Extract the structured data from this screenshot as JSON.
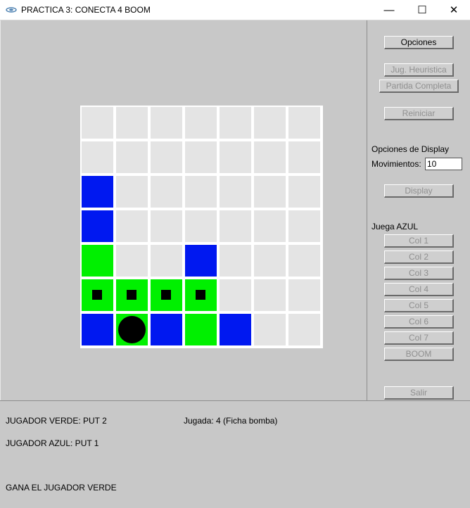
{
  "window": {
    "title": "PRACTICA 3: CONECTA 4 BOOM",
    "minimize_glyph": "—",
    "maximize_glyph": "☐",
    "close_glyph": "✕"
  },
  "board": {
    "rows": 7,
    "cols": 7,
    "colors": {
      "empty": "#e4e4e4",
      "blue": "#0018f0",
      "green": "#00f000",
      "marker": "#000000"
    },
    "cells": [
      [
        "empty",
        "empty",
        "empty",
        "empty",
        "empty",
        "empty",
        "empty"
      ],
      [
        "empty",
        "empty",
        "empty",
        "empty",
        "empty",
        "empty",
        "empty"
      ],
      [
        "blue",
        "empty",
        "empty",
        "empty",
        "empty",
        "empty",
        "empty"
      ],
      [
        "blue",
        "empty",
        "empty",
        "empty",
        "empty",
        "empty",
        "empty"
      ],
      [
        "green",
        "empty",
        "empty",
        "blue",
        "empty",
        "empty",
        "empty"
      ],
      [
        "green-marked",
        "green-marked",
        "green-marked",
        "green-marked",
        "empty",
        "empty",
        "empty"
      ],
      [
        "blue",
        "green-bomb",
        "blue",
        "green",
        "blue",
        "empty",
        "empty"
      ]
    ]
  },
  "panel": {
    "opciones": "Opciones",
    "jug_heuristica": "Jug. Heuristica",
    "partida_completa": "Partida Completa",
    "reiniciar": "Reiniciar",
    "display_options_label": "Opciones de Display",
    "movimientos_label": "Movimientos:",
    "movimientos_value": "10",
    "display": "Display",
    "turn_label": "Juega AZUL",
    "columns": [
      "Col 1",
      "Col 2",
      "Col 3",
      "Col 4",
      "Col 5",
      "Col 6",
      "Col 7"
    ],
    "boom": "BOOM",
    "salir": "Salir"
  },
  "status": {
    "player_green": "JUGADOR VERDE: PUT 2",
    "play_info": "Jugada: 4 (Ficha bomba)",
    "player_blue": "JUGADOR AZUL: PUT 1",
    "result": "GANA EL JUGADOR VERDE"
  }
}
